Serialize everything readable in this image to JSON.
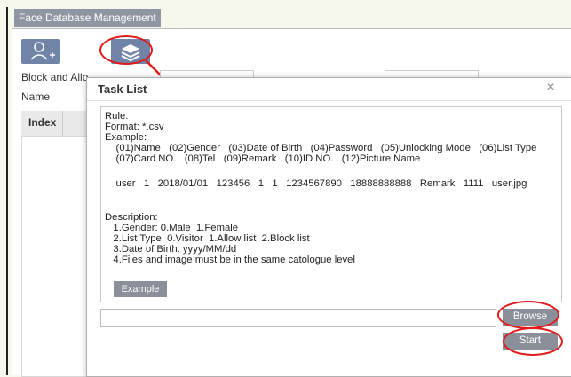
{
  "tab": {
    "label": "Face Database Management"
  },
  "background": {
    "block_label": "Block and Allo",
    "name_label": "Name",
    "table_header_index": "Index"
  },
  "dialog": {
    "title": "Task List",
    "close_glyph": "×",
    "rule": {
      "heading": "Rule:",
      "format": "Format: *.csv",
      "example_heading": "Example:",
      "fields_line1": "    (01)Name   (02)Gender   (03)Date of Birth   (04)Password   (05)Unlocking Mode   (06)List Type",
      "fields_line2": "    (07)Card NO.   (08)Tel   (09)Remark   (10)ID NO.   (12)Picture Name",
      "sample_row": "    user   1   2018/01/01   123456   1   1   1234567890   18888888888   Remark   1111   user.jpg",
      "desc_heading": "Description:",
      "desc1": "   1.Gender: 0.Male  1.Female",
      "desc2": "   2.List Type: 0.Visitor  1.Allow list  2.Block list",
      "desc3": "   3.Date of Birth: yyyy/MM/dd",
      "desc4": "   4.Files and image must be in the same catologue level"
    },
    "example_button": "Example",
    "browse_button": "Browse",
    "start_button": "Start",
    "file_value": ""
  },
  "colors": {
    "accent": "#6f84a6",
    "button": "#8a8f99",
    "highlight": "#e01b1b"
  }
}
